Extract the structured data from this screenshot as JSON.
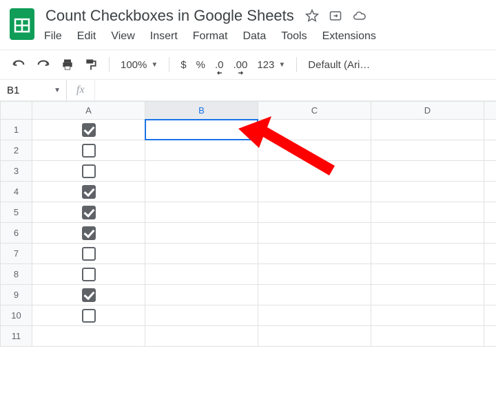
{
  "doc_title": "Count Checkboxes in Google Sheets",
  "menu": {
    "file": "File",
    "edit": "Edit",
    "view": "View",
    "insert": "Insert",
    "format": "Format",
    "data": "Data",
    "tools": "Tools",
    "extensions": "Extensions"
  },
  "toolbar": {
    "zoom": "100%",
    "currency": "$",
    "percent": "%",
    "dec_down": ".0",
    "dec_up": ".00",
    "num_fmt": "123",
    "font": "Default (Ari…"
  },
  "name_box": "B1",
  "fx_label": "fx",
  "formula_value": "",
  "columns": [
    "A",
    "B",
    "C",
    "D"
  ],
  "row_numbers": [
    1,
    2,
    3,
    4,
    5,
    6,
    7,
    8,
    9,
    10,
    11
  ],
  "checkbox_rows": {
    "1": true,
    "2": false,
    "3": false,
    "4": true,
    "5": true,
    "6": true,
    "7": false,
    "8": false,
    "9": true,
    "10": false
  },
  "selected_cell": "B1"
}
